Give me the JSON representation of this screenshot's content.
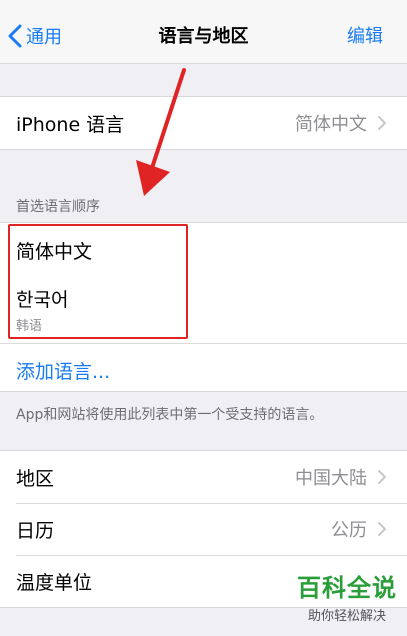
{
  "nav": {
    "back_label": "通用",
    "title": "语言与地区",
    "edit_label": "编辑"
  },
  "iphone_language": {
    "label": "iPhone 语言",
    "value": "简体中文"
  },
  "preferred_order": {
    "header": "首选语言顺序",
    "items": [
      {
        "label": "简体中文"
      },
      {
        "label": "한국어",
        "sublabel": "韩语"
      }
    ],
    "add_label": "添加语言..."
  },
  "footer_note": "App和网站将使用此列表中第一个受支持的语言。",
  "region_group": {
    "rows": [
      {
        "label": "地区",
        "value": "中国大陆"
      },
      {
        "label": "日历",
        "value": "公历"
      },
      {
        "label": "温度单位",
        "value": ""
      }
    ]
  },
  "watermark": {
    "main": "百科全说",
    "sub": "助你轻松解决"
  },
  "colors": {
    "accent": "#1a7cf5",
    "highlight": "#e02424",
    "watermark": "#2b9e3a"
  }
}
